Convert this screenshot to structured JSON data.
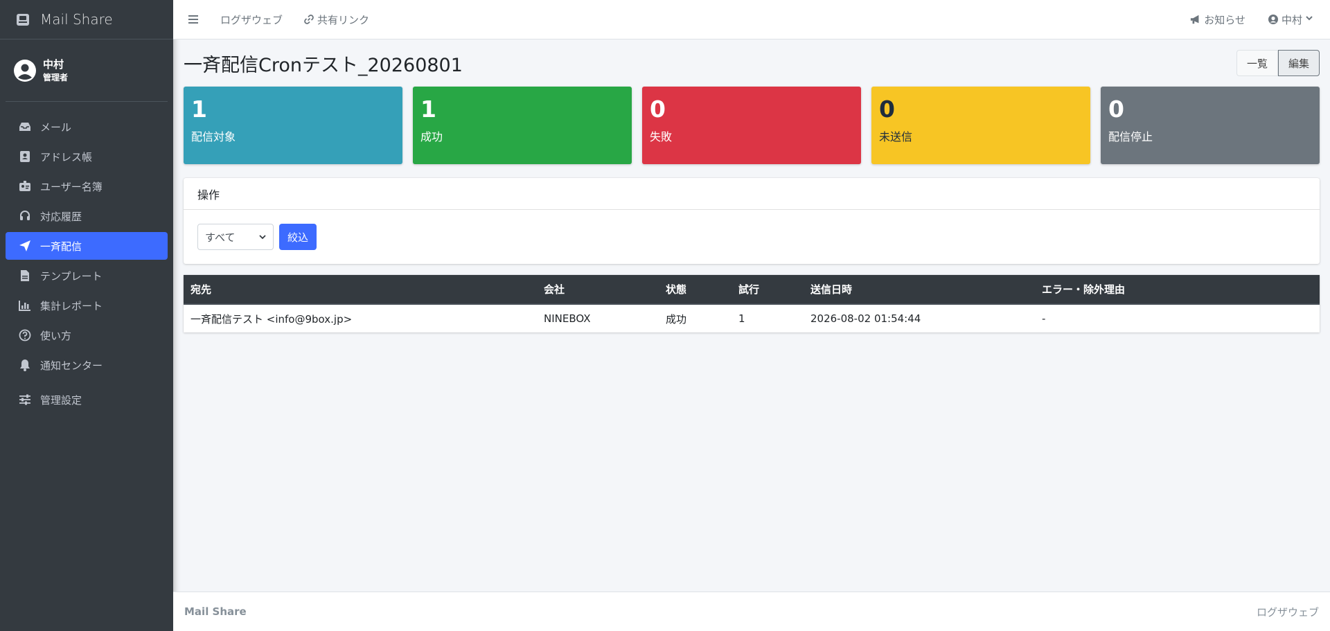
{
  "brand": {
    "name": "Mail Share"
  },
  "user": {
    "name": "中村",
    "role": "管理者"
  },
  "sidebar": {
    "items": [
      {
        "label": "メール",
        "icon": "inbox-icon"
      },
      {
        "label": "アドレス帳",
        "icon": "address-book-icon"
      },
      {
        "label": "ユーザー名簿",
        "icon": "id-badge-icon"
      },
      {
        "label": "対応履歴",
        "icon": "headset-icon"
      },
      {
        "label": "一斉配信",
        "icon": "paper-plane-icon",
        "active": true
      },
      {
        "label": "テンプレート",
        "icon": "file-icon"
      },
      {
        "label": "集計レポート",
        "icon": "chart-bar-icon"
      },
      {
        "label": "使い方",
        "icon": "question-circle-icon"
      },
      {
        "label": "通知センター",
        "icon": "bell-icon"
      },
      {
        "label": "管理設定",
        "icon": "sliders-icon"
      }
    ]
  },
  "topbar": {
    "link1": "ログザウェブ",
    "link2": "共有リンク",
    "notice": "お知らせ",
    "user": "中村"
  },
  "page": {
    "title": "一斉配信Cronテスト_20260801",
    "btn_list": "一覧",
    "btn_edit": "編集"
  },
  "stats": [
    {
      "value": "1",
      "label": "配信対象",
      "color": "#35a0b8"
    },
    {
      "value": "1",
      "label": "成功",
      "color": "#28a745"
    },
    {
      "value": "0",
      "label": "失敗",
      "color": "#dc3545"
    },
    {
      "value": "0",
      "label": "未送信",
      "color": "#f7c524"
    },
    {
      "value": "0",
      "label": "配信停止",
      "color": "#6c757d"
    }
  ],
  "ops": {
    "header": "操作",
    "filter_value": "すべて",
    "filter_button": "絞込"
  },
  "table": {
    "headers": [
      "宛先",
      "会社",
      "状態",
      "試行",
      "送信日時",
      "エラー・除外理由"
    ],
    "rows": [
      [
        "一斉配信テスト <info@9box.jp>",
        "NINEBOX",
        "成功",
        "1",
        "2026-08-02 01:54:44",
        "-"
      ]
    ]
  },
  "footer": {
    "left": "Mail Share",
    "right": "ログザウェブ"
  },
  "colors": {
    "accent": "#3d6bff",
    "sidebar": "#343a40"
  }
}
